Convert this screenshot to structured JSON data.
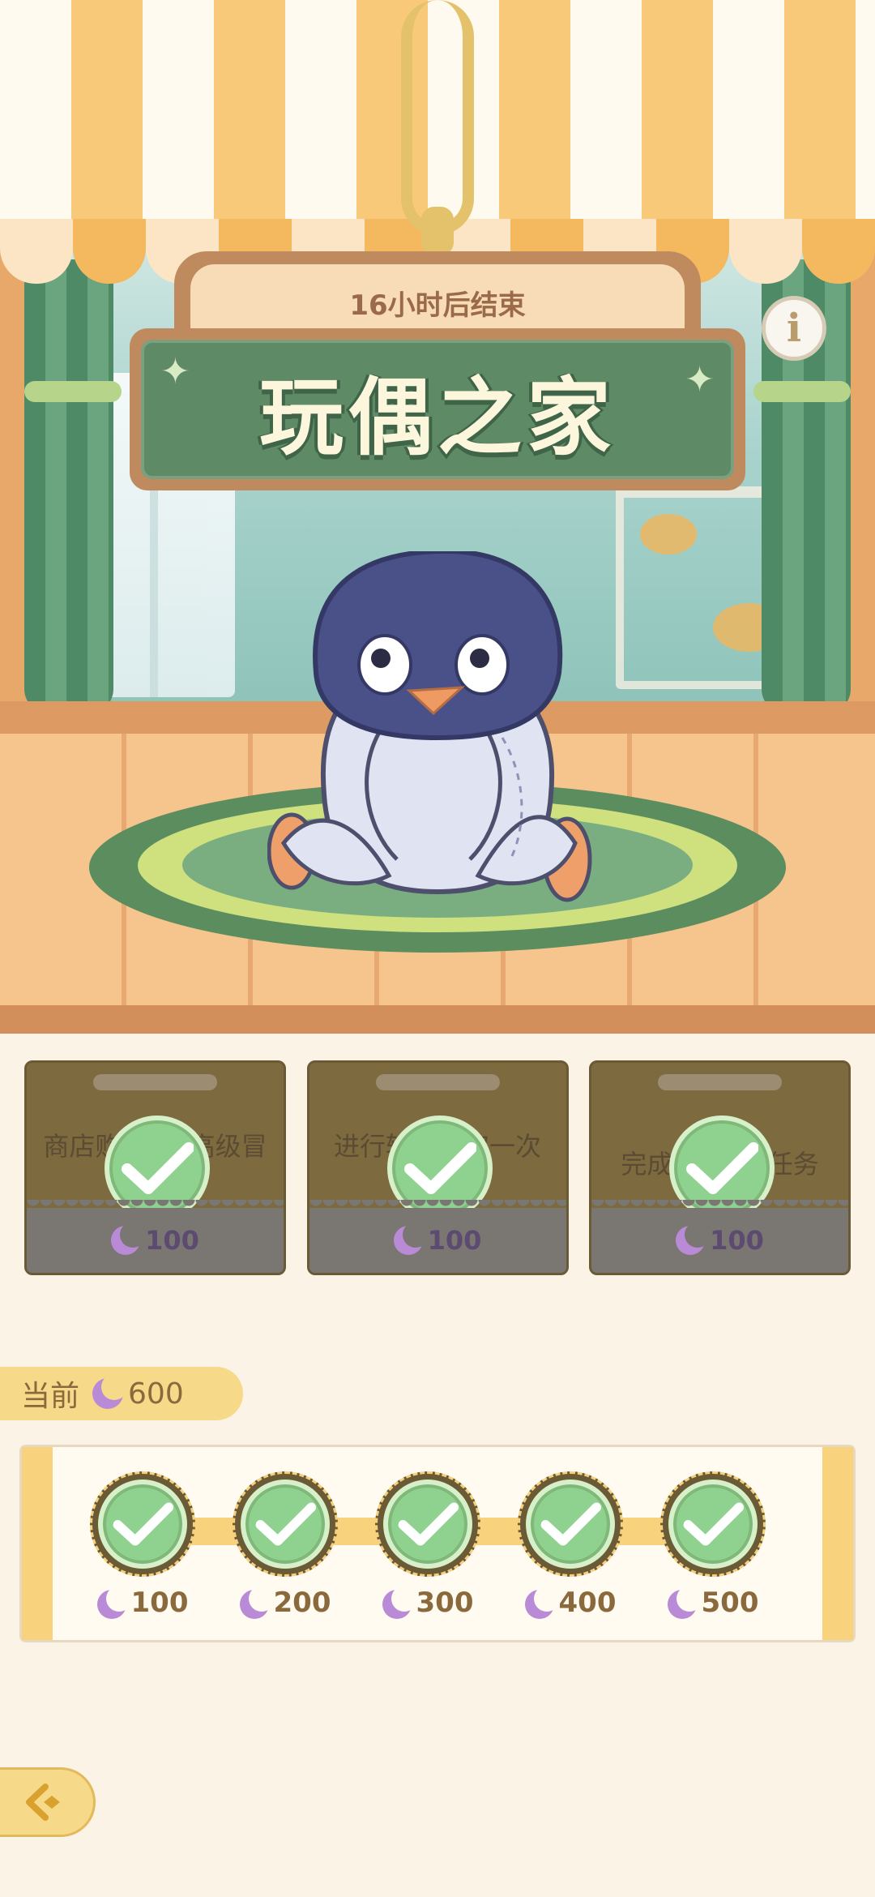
{
  "event": {
    "countdown": "16小时后结束",
    "title": "玩偶之家",
    "info_icon": "info-icon"
  },
  "quests": [
    {
      "desc": "商店购买3张高级冒险券",
      "reward": "100",
      "status": "completed"
    },
    {
      "desc": "进行转动获取一次",
      "reward": "100",
      "status": "completed"
    },
    {
      "desc": "完成3次每日任务",
      "reward": "100",
      "status": "completed"
    }
  ],
  "current": {
    "label": "当前",
    "value": "600"
  },
  "milestones": [
    {
      "value": "100",
      "status": "claimed"
    },
    {
      "value": "200",
      "status": "claimed"
    },
    {
      "value": "300",
      "status": "claimed"
    },
    {
      "value": "400",
      "status": "claimed"
    },
    {
      "value": "500",
      "status": "claimed"
    }
  ],
  "colors": {
    "accent": "#f7d98a",
    "sign_green": "#5e8a66",
    "check_green": "#8fd28f",
    "moon": "#b98ad6"
  },
  "icons": {
    "currency": "moon-icon",
    "check": "check-icon",
    "back": "back-arrow-icon"
  }
}
